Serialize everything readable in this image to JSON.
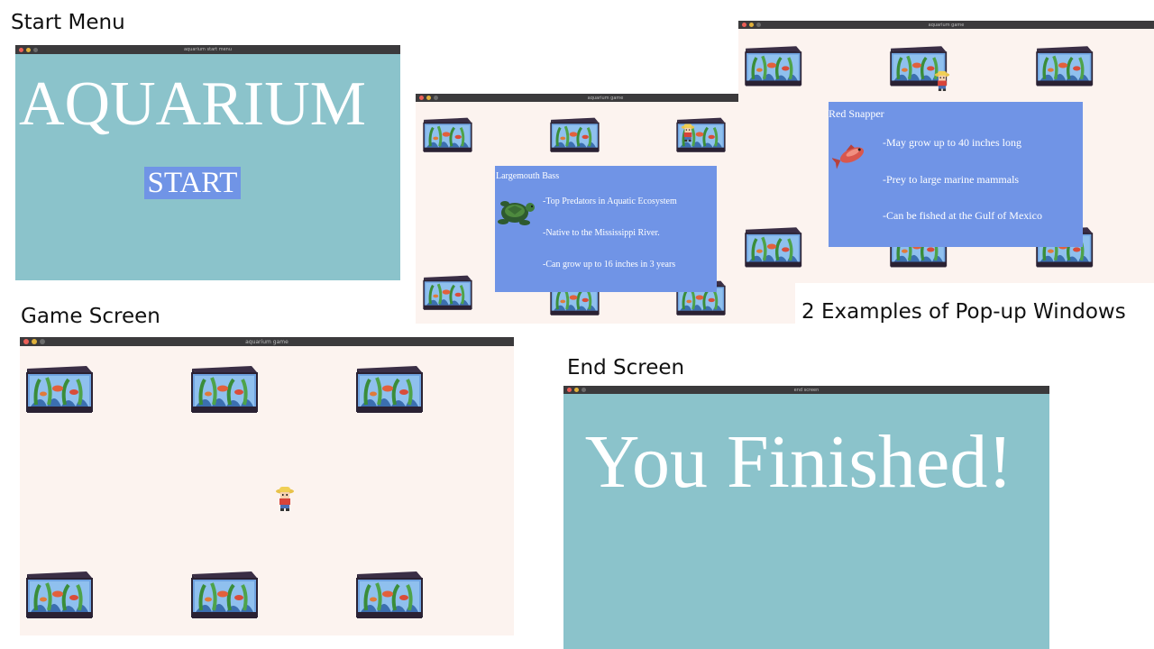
{
  "captions": {
    "start_menu": "Start Menu",
    "game_screen": "Game Screen",
    "popup_examples": "2 Examples of Pop-up Windows",
    "end_screen": "End Screen"
  },
  "start_window": {
    "window_title": "aquarium start menu",
    "heading": "AQUARIUM",
    "start_button": "START"
  },
  "popup_window_1": {
    "window_title": "aquarium game",
    "popup": {
      "fish_name": "Largemouth Bass",
      "facts": [
        "-Top Predators in Aquatic Ecosystem",
        "-Native to the Mississippi River.",
        "-Can grow up to 16 inches in 3 years"
      ],
      "icon": "turtle-icon"
    }
  },
  "popup_window_2": {
    "window_title": "aquarium game",
    "popup": {
      "fish_name": "Red Snapper",
      "facts": [
        "-May grow up to 40 inches long",
        "-Prey to large marine mammals",
        "-Can be fished at the Gulf of Mexico"
      ],
      "icon": "red-fish-icon"
    }
  },
  "game_window": {
    "window_title": "aquarium game"
  },
  "end_window": {
    "window_title": "end screen",
    "message": "You Finished!"
  },
  "colors": {
    "teal_background": "#8bc3cb",
    "game_background": "#fcf3ef",
    "popup_background": "#7094e6",
    "start_button_background": "#7094e6",
    "titlebar": "#3b3a3c"
  }
}
